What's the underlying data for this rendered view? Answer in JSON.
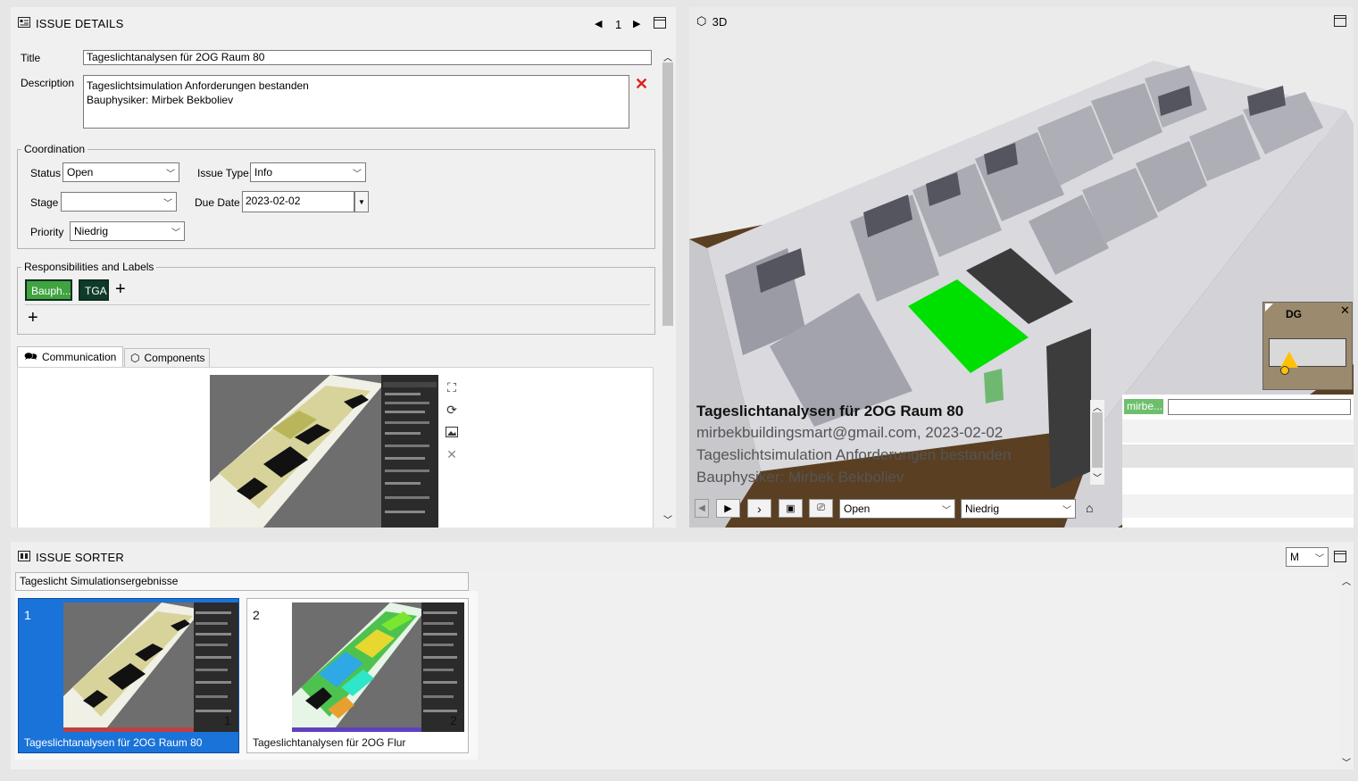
{
  "issue_details": {
    "title": "ISSUE DETAILS",
    "page_number": "1",
    "fields": {
      "title_label": "Title",
      "title_value": "Tageslichtanalysen für 2OG Raum 80",
      "description_label": "Description",
      "description_line1": "Tageslichtsimulation Anforderungen bestanden",
      "description_line2": "Bauphysiker: Mirbek Bekboliev"
    },
    "coordination": {
      "legend": "Coordination",
      "status_label": "Status",
      "status_value": "Open",
      "issue_type_label": "Issue Type",
      "issue_type_value": "Info",
      "stage_label": "Stage",
      "stage_value": "",
      "due_date_label": "Due Date",
      "due_date_value": "2023-02-02",
      "priority_label": "Priority",
      "priority_value": "Niedrig"
    },
    "responsibilities": {
      "legend": "Responsibilities and Labels",
      "tags": [
        {
          "label": "Bauph...",
          "color": "#3fa33f"
        },
        {
          "label": "TGA",
          "color": "#0e3b2a"
        }
      ]
    },
    "tabs": [
      {
        "label": "Communication",
        "active": true
      },
      {
        "label": "Components",
        "active": false
      }
    ]
  },
  "view3d": {
    "title": "3D",
    "overlay": {
      "title": "Tageslichtanalysen für 2OG Raum 80",
      "meta": "mirbekbuildingsmart@gmail.com, 2023-02-02",
      "line1": "Tageslichtsimulation Anforderungen bestanden",
      "line2": "Bauphysiker: Mirbek Bekboliev"
    },
    "status_select": "Open",
    "priority_select": "Niedrig",
    "minimap_label": "DG",
    "side_tag": "mirbe...",
    "colors": {
      "ground": "#5a3f22",
      "highlight": "#00e000",
      "sky": "#ebebeb"
    }
  },
  "issue_sorter": {
    "title": "ISSUE SORTER",
    "size_select": "M",
    "group_name": "Tageslicht Simulationsergebnisse",
    "cards": [
      {
        "number": "1",
        "overlay_number": "1",
        "caption": "Tageslichtanalysen für 2OG Raum 80",
        "selected": true
      },
      {
        "number": "2",
        "overlay_number": "2",
        "caption": "Tageslichtanalysen für 2OG Flur",
        "selected": false
      }
    ]
  },
  "accent": "#1a73d9"
}
